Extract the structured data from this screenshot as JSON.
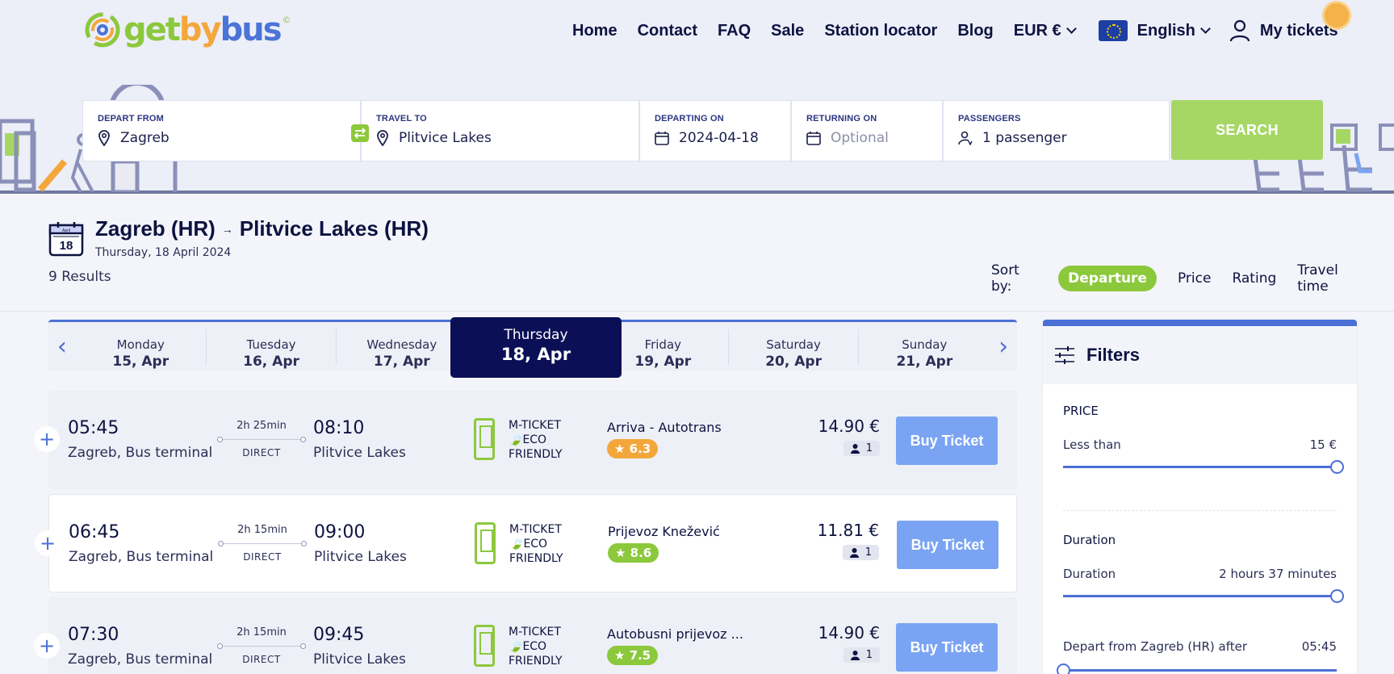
{
  "brand": {
    "logo_text_1": "get",
    "logo_text_2": "by",
    "logo_text_3": "bus",
    "logo_mark": "©"
  },
  "nav": {
    "home": "Home",
    "contact": "Contact",
    "faq": "FAQ",
    "sale": "Sale",
    "station_locator": "Station locator",
    "blog": "Blog",
    "currency": "EUR €",
    "language": "English",
    "my_tickets": "My tickets"
  },
  "search": {
    "depart_label": "DEPART FROM",
    "depart_value": "Zagreb",
    "travel_label": "TRAVEL TO",
    "travel_value": "Plitvice Lakes",
    "departing_label": "DEPARTING ON",
    "departing_value": "2024-04-18",
    "returning_label": "RETURNING ON",
    "returning_placeholder": "Optional",
    "passengers_label": "PASSENGERS",
    "passengers_value": "1 passenger",
    "search_button": "SEARCH"
  },
  "summary": {
    "calendar_month": "April",
    "calendar_day": "18",
    "origin": "Zagreb (HR)",
    "arrow": "→",
    "destination": "Plitvice Lakes (HR)",
    "date_text": "Thursday, 18 April 2024",
    "results": "9 Results",
    "sort_label": "Sort by:",
    "sort_options": [
      "Departure",
      "Price",
      "Rating",
      "Travel time"
    ]
  },
  "dates": [
    {
      "day": "Monday",
      "date": "15, Apr"
    },
    {
      "day": "Tuesday",
      "date": "16, Apr"
    },
    {
      "day": "Wednesday",
      "date": "17, Apr"
    },
    {
      "day": "Thursday",
      "date": "18, Apr"
    },
    {
      "day": "Friday",
      "date": "19, Apr"
    },
    {
      "day": "Saturday",
      "date": "20, Apr"
    },
    {
      "day": "Sunday",
      "date": "21, Apr"
    }
  ],
  "trips": [
    {
      "dep_time": "05:45",
      "dep_place": "Zagreb, Bus terminal",
      "duration": "2h 25min",
      "type": "DIRECT",
      "arr_time": "08:10",
      "arr_place": "Plitvice Lakes",
      "ticket_1": "M-TICKET",
      "ticket_2": "ECO",
      "ticket_3": "FRIENDLY",
      "operator": "Arriva - Autotrans",
      "rating": "6.3",
      "rating_color": "#f3a73b",
      "price": "14.90 €",
      "passengers": "1",
      "buy": "Buy Ticket"
    },
    {
      "dep_time": "06:45",
      "dep_place": "Zagreb, Bus terminal",
      "duration": "2h 15min",
      "type": "DIRECT",
      "arr_time": "09:00",
      "arr_place": "Plitvice Lakes",
      "ticket_1": "M-TICKET",
      "ticket_2": "ECO",
      "ticket_3": "FRIENDLY",
      "operator": "Prijevoz Knežević",
      "rating": "8.6",
      "rating_color": "#8cc83c",
      "price": "11.81 €",
      "passengers": "1",
      "buy": "Buy Ticket"
    },
    {
      "dep_time": "07:30",
      "dep_place": "Zagreb, Bus terminal",
      "duration": "2h 15min",
      "type": "DIRECT",
      "arr_time": "09:45",
      "arr_place": "Plitvice Lakes",
      "ticket_1": "M-TICKET",
      "ticket_2": "ECO",
      "ticket_3": "FRIENDLY",
      "operator": "Autobusni prijevoz ...",
      "rating": "7.5",
      "rating_color": "#8cc83c",
      "price": "14.90 €",
      "passengers": "1",
      "buy": "Buy Ticket"
    }
  ],
  "filters": {
    "title": "Filters",
    "price_label": "PRICE",
    "price_less_than": "Less than",
    "price_value": "15 €",
    "price_level": 1.0,
    "duration_label": "Duration",
    "duration_row_label": "Duration",
    "duration_value": "2 hours 37 minutes",
    "duration_level": 1.0,
    "depart_after_label": "Depart from Zagreb (HR) after",
    "depart_after_value": "05:45",
    "depart_after_level": 0.0
  },
  "colors": {
    "accent_blue": "#4b6fd6",
    "brand_green": "#8cc83c",
    "brand_orange": "#f3a73b",
    "dark_navy": "#0b1056",
    "buy_button": "#7aa4f3"
  },
  "icons": {
    "location": "location-pin-icon",
    "calendar": "calendar-icon",
    "passenger": "passenger-icon",
    "swap": "swap-icon",
    "user": "user-icon",
    "filters": "sliders-icon"
  }
}
